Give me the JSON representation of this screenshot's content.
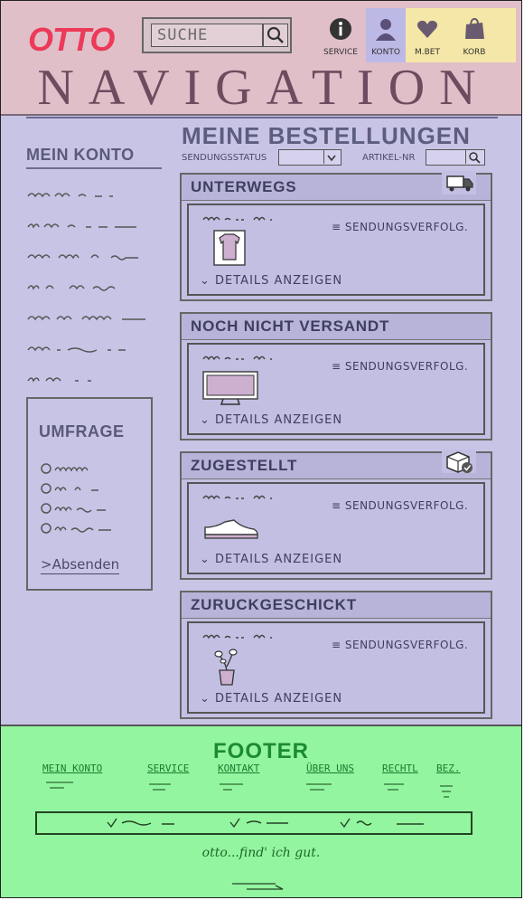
{
  "header": {
    "logo": "OTTO",
    "search": {
      "placeholder": "SUCHE"
    },
    "icons": [
      {
        "label": "SERVICE",
        "icon": "info-icon"
      },
      {
        "label": "KONTO",
        "icon": "user-icon"
      },
      {
        "label": "M.BET",
        "icon": "heart-icon"
      },
      {
        "label": "KORB",
        "icon": "bag-icon"
      }
    ],
    "navigation_label": "NAVIGATION"
  },
  "colors": {
    "header_bg": "#e0bfc9",
    "body_bg": "#c8c4e6",
    "konto_highlight": "#bdb9e6",
    "icons_highlight": "#f4e7a7",
    "footer_bg": "#94f5a0",
    "logo": "#ec3a58"
  },
  "sidebar": {
    "title": "MEIN KONTO",
    "survey": {
      "title": "UMFRAGE",
      "submit": ">Absenden"
    }
  },
  "main": {
    "title": "MEINE BESTELLUNGEN",
    "filters": {
      "status_label": "SENDUNGSSTATUS",
      "article_label": "ARTIKEL-NR"
    },
    "orders": [
      {
        "title": "UNTERWEGS",
        "tracking": "≡ SENDUNGSVERFOLG.",
        "details": "⌄ DETAILS ANZEIGEN",
        "item": "shirt-icon",
        "badge": "delivery-truck-icon"
      },
      {
        "title": "NOCH NICHT VERSANDT",
        "tracking": "≡ SENDUNGSVERFOLG.",
        "details": "⌄ DETAILS ANZEIGEN",
        "item": "tv-icon",
        "badge": ""
      },
      {
        "title": "ZUGESTELLT",
        "tracking": "≡ SENDUNGSVERFOLG.",
        "details": "⌄ DETAILS ANZEIGEN",
        "item": "shoe-icon",
        "badge": "package-delivered-icon"
      },
      {
        "title": "ZURUCKGESCHICKT",
        "tracking": "≡ SENDUNGSVERFOLG.",
        "details": "⌄ DETAILS ANZEIGEN",
        "item": "plant-icon",
        "badge": ""
      }
    ]
  },
  "footer": {
    "title": "FOOTER",
    "links": [
      "MEIN KONTO",
      "SERVICE",
      "KONTAKT",
      "ÜBER UNS",
      "RECHTL",
      "BEZ."
    ],
    "slogan": "otto...find' ich gut."
  }
}
